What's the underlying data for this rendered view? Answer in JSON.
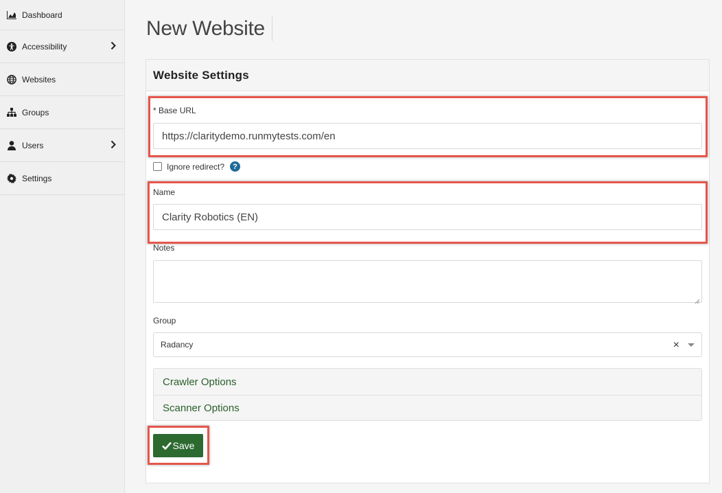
{
  "sidebar": {
    "items": [
      {
        "label": "Dashboard",
        "icon": "chart-area-icon"
      },
      {
        "label": "Accessibility",
        "icon": "universal-access-icon",
        "has_submenu": true
      },
      {
        "label": "Websites",
        "icon": "globe-icon"
      },
      {
        "label": "Groups",
        "icon": "sitemap-icon"
      },
      {
        "label": "Users",
        "icon": "user-icon",
        "has_submenu": true
      },
      {
        "label": "Settings",
        "icon": "gear-icon"
      }
    ]
  },
  "page": {
    "title": "New Website"
  },
  "form": {
    "panel_title": "Website Settings",
    "base_url": {
      "label": "* Base URL",
      "value": "https://claritydemo.runmytests.com/en"
    },
    "ignore_redirect": {
      "label": "Ignore redirect?",
      "checked": false,
      "help_icon": "question-circle-icon"
    },
    "name": {
      "label": "Name",
      "value": "Clarity Robotics (EN)"
    },
    "notes": {
      "label": "Notes",
      "value": ""
    },
    "group": {
      "label": "Group",
      "value": "Radancy"
    },
    "accordion": [
      "Crawler Options",
      "Scanner Options"
    ],
    "save_label": "Save"
  },
  "colors": {
    "accent_green": "#2d6a30",
    "highlight_red": "#e5564b",
    "help_blue": "#1d6a98"
  }
}
